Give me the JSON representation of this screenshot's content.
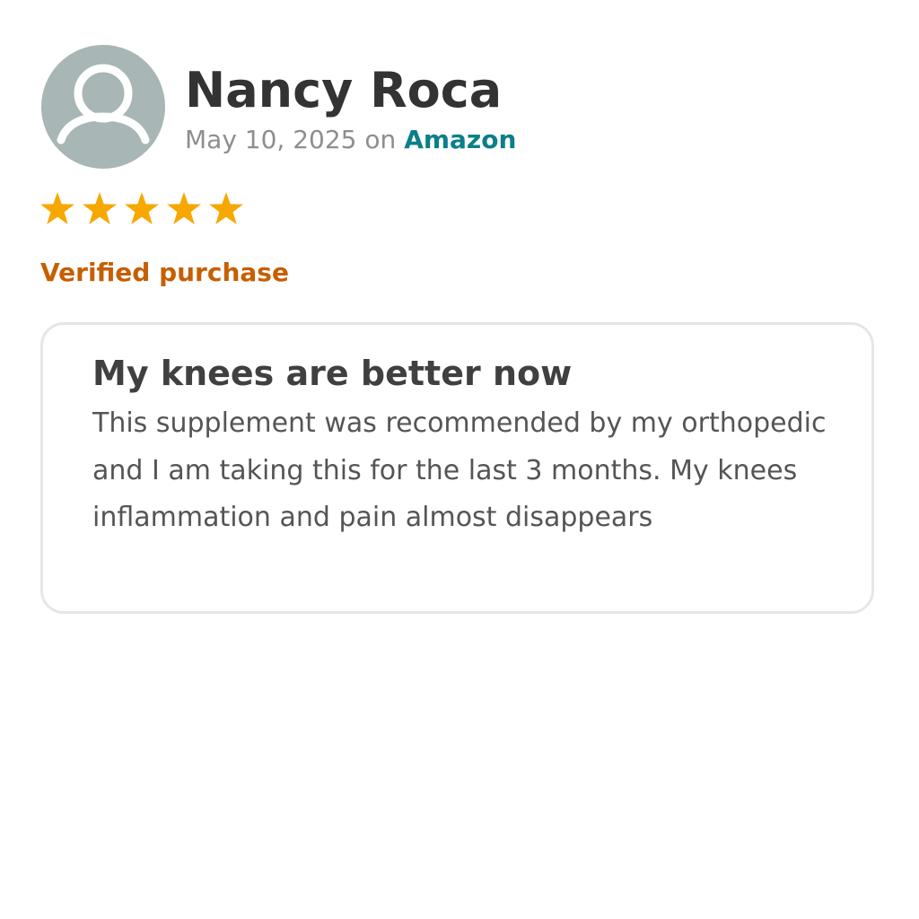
{
  "review": {
    "author": "Nancy Roca",
    "date": "May 10, 2025",
    "on_label": "on",
    "source": "Amazon",
    "rating": 5,
    "max_rating": 5,
    "verified_label": "Verified purchase",
    "title": "My knees are better now",
    "body": "This supplement was recommended by my orthopedic and I am taking this for the last 3 months. My knees inflammation and pain almost disappears"
  },
  "icons": {
    "avatar": "user-silhouette-icon",
    "rating": "star-icon"
  },
  "colors": {
    "avatar_bg": "#a8b6b5",
    "author": "#333333",
    "meta": "#8e8e8e",
    "source": "#0b7f8a",
    "star": "#f6a800",
    "verified": "#c65f00",
    "card_border": "#e6e6e6",
    "title": "#404040",
    "body": "#555555"
  }
}
